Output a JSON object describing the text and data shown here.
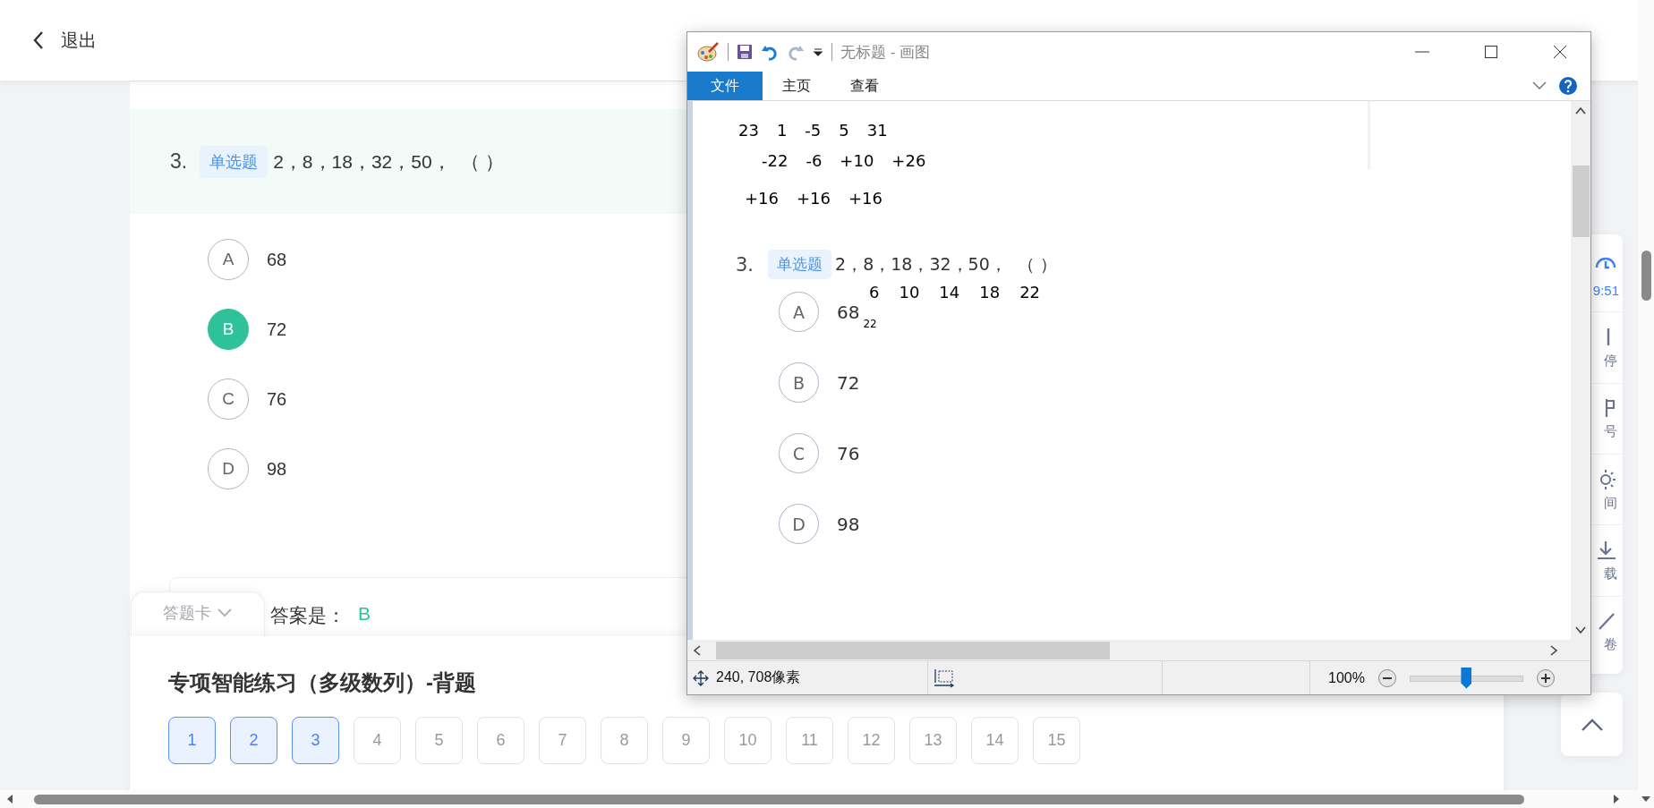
{
  "header": {
    "back_label": "退出"
  },
  "question": {
    "number": "3.",
    "type_tag": "单选题",
    "text": "2，8，18，32，50，  （ ）",
    "options": [
      {
        "letter": "A",
        "text": "68",
        "selected": false
      },
      {
        "letter": "B",
        "text": "72",
        "selected": true
      },
      {
        "letter": "C",
        "text": "76",
        "selected": false
      },
      {
        "letter": "D",
        "text": "98",
        "selected": false
      }
    ]
  },
  "answer": {
    "label": "答案是：",
    "value": "B"
  },
  "answer_card": {
    "toggle_label": "答题卡",
    "title": "专项智能练习（多级数列）-背题",
    "numbers": [
      {
        "label": "1",
        "answered": true
      },
      {
        "label": "2",
        "answered": true
      },
      {
        "label": "3",
        "answered": true
      },
      {
        "label": "4",
        "answered": false
      },
      {
        "label": "5",
        "answered": false
      },
      {
        "label": "6",
        "answered": false
      },
      {
        "label": "7",
        "answered": false
      },
      {
        "label": "8",
        "answered": false
      },
      {
        "label": "9",
        "answered": false
      },
      {
        "label": "10",
        "answered": false
      },
      {
        "label": "11",
        "answered": false
      },
      {
        "label": "12",
        "answered": false
      },
      {
        "label": "13",
        "answered": false
      },
      {
        "label": "14",
        "answered": false
      },
      {
        "label": "15",
        "answered": false
      }
    ]
  },
  "tool_sidebar": {
    "items": [
      {
        "kind": "timer",
        "label": "9:51"
      },
      {
        "kind": "pause",
        "label": "停"
      },
      {
        "kind": "flag",
        "label": "号"
      },
      {
        "kind": "light",
        "label": "间"
      },
      {
        "kind": "download",
        "label": "载"
      },
      {
        "kind": "pen",
        "label": "卷"
      }
    ]
  },
  "paint_window": {
    "title": "无标题 - 画图",
    "tabs": [
      {
        "label": "文件",
        "selected": true
      },
      {
        "label": "主页",
        "selected": false
      },
      {
        "label": "查看",
        "selected": false
      }
    ],
    "canvas": {
      "notes": [
        [
          "23",
          "1",
          "-5",
          "5",
          "31"
        ],
        [
          "-22",
          "-6",
          "+10",
          "+26"
        ],
        [
          "+16",
          "+16",
          "+16"
        ]
      ],
      "question": {
        "number": "3.",
        "type_tag": "单选题",
        "text": "2，8，18，32，50，  （ ）"
      },
      "differences": [
        "6",
        "10",
        "14",
        "18",
        "22"
      ],
      "stray_note": "22",
      "options": [
        {
          "letter": "A",
          "text": "68"
        },
        {
          "letter": "B",
          "text": "72"
        },
        {
          "letter": "C",
          "text": "76"
        },
        {
          "letter": "D",
          "text": "98"
        }
      ]
    },
    "status": {
      "position": "240, 708像素",
      "zoom": "100%",
      "level": 0.5
    }
  }
}
